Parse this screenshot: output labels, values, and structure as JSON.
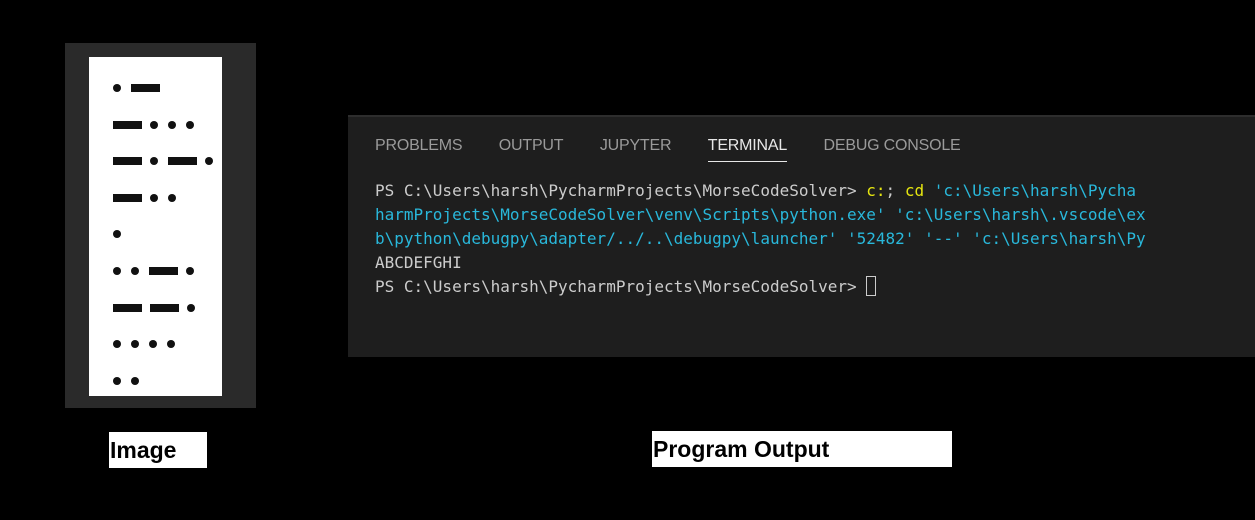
{
  "morse": {
    "rows": [
      [
        ".",
        "-"
      ],
      [
        "-",
        ".",
        ".",
        "."
      ],
      [
        "-",
        ".",
        "-",
        "."
      ],
      [
        "-",
        ".",
        "."
      ],
      [
        "."
      ],
      [
        ".",
        ".",
        "-",
        "."
      ],
      [
        "-",
        "-",
        "."
      ],
      [
        ".",
        ".",
        ".",
        "."
      ],
      [
        ".",
        "."
      ]
    ]
  },
  "captions": {
    "image": "Image",
    "output": "Program Output"
  },
  "terminal": {
    "tabs": [
      "PROBLEMS",
      "OUTPUT",
      "JUPYTER",
      "TERMINAL",
      "DEBUG CONSOLE"
    ],
    "active_tab": "TERMINAL",
    "line1": {
      "prompt": "PS C:\\Users\\harsh\\PycharmProjects\\MorseCodeSolver> ",
      "cmd1": "c:",
      "sep": "; ",
      "cmd2": "cd",
      "path": " 'c:\\Users\\harsh\\Pycha"
    },
    "line2": "harmProjects\\MorseCodeSolver\\venv\\Scripts\\python.exe' 'c:\\Users\\harsh\\.vscode\\ex",
    "line3": "b\\python\\debugpy\\adapter/../..\\debugpy\\launcher' '52482' '--' 'c:\\Users\\harsh\\Py",
    "output_line": "ABCDEFGHI",
    "line5_prompt": "PS C:\\Users\\harsh\\PycharmProjects\\MorseCodeSolver> "
  }
}
